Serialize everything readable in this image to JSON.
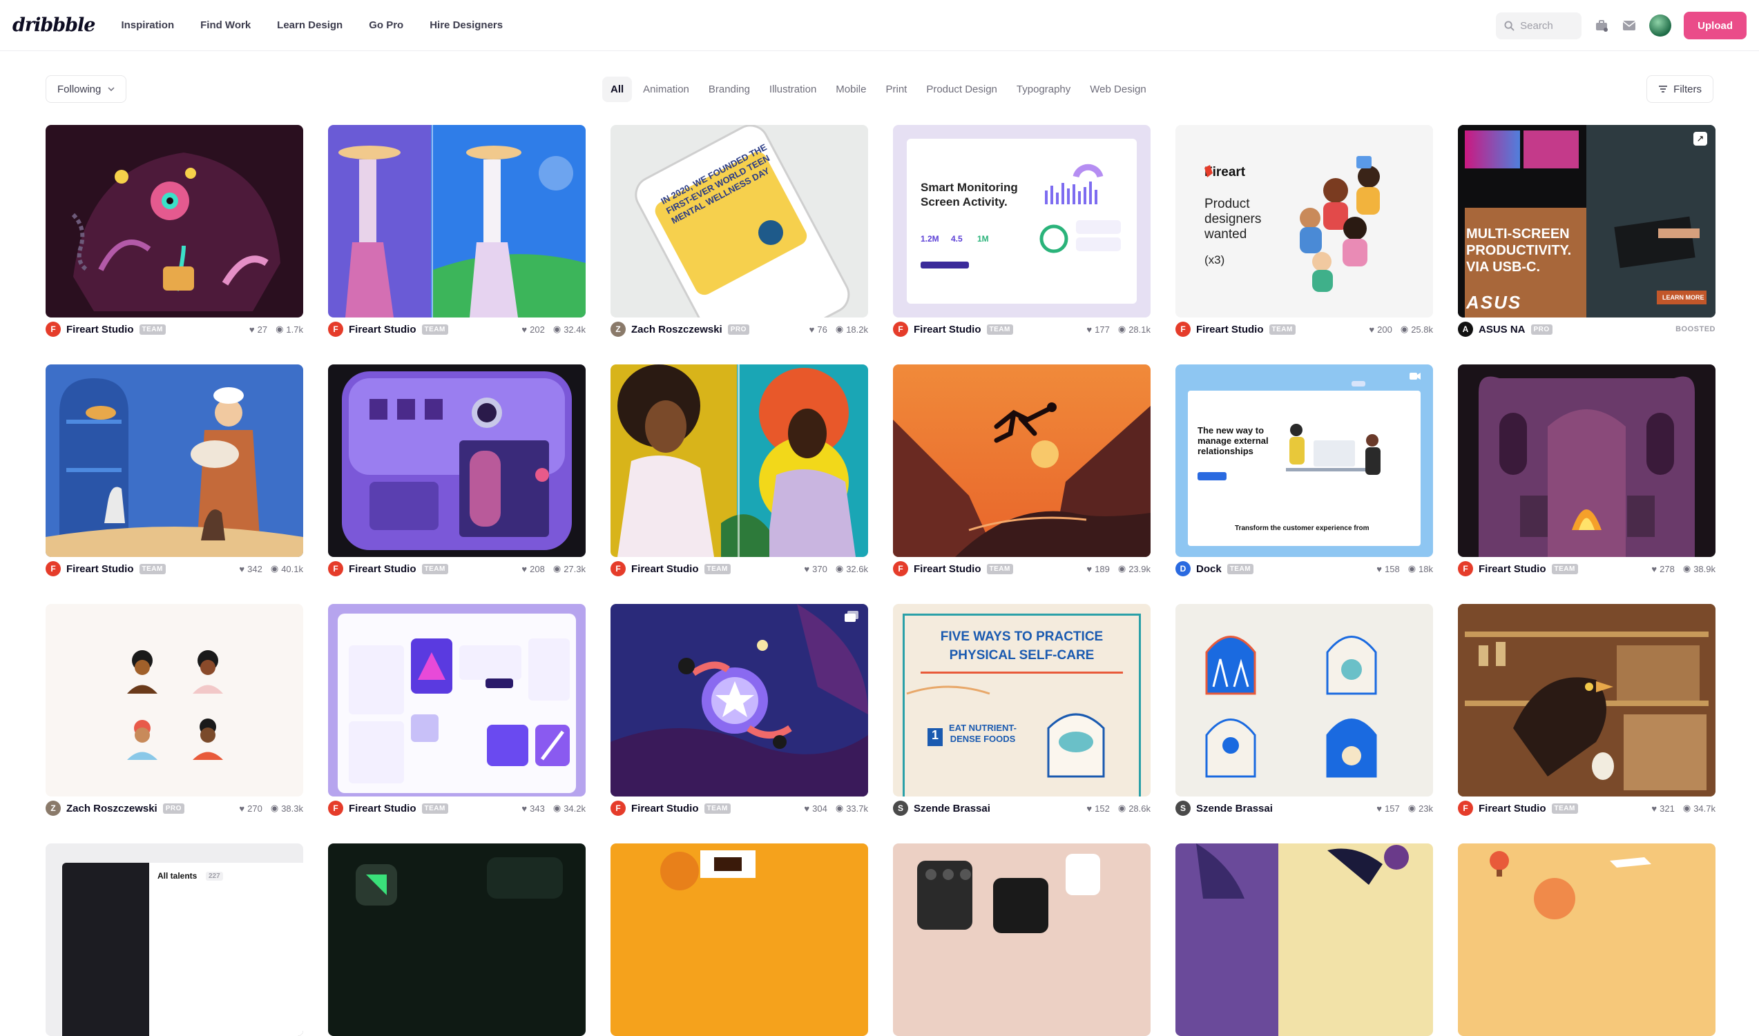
{
  "header": {
    "logo": "dribbble",
    "nav": [
      "Inspiration",
      "Find Work",
      "Learn Design",
      "Go Pro",
      "Hire Designers"
    ],
    "search_placeholder": "Search",
    "upload_label": "Upload"
  },
  "filterbar": {
    "following_label": "Following",
    "categories": [
      "All",
      "Animation",
      "Branding",
      "Illustration",
      "Mobile",
      "Print",
      "Product Design",
      "Typography",
      "Web Design"
    ],
    "active_category": "All",
    "filters_label": "Filters"
  },
  "colors": {
    "accent": "#ea4c89",
    "fireart": "#e53c2a"
  },
  "shots": [
    {
      "author": "Fireart Studio",
      "badge": "TEAM",
      "likes": "27",
      "views": "1.7k"
    },
    {
      "author": "Fireart Studio",
      "badge": "TEAM",
      "likes": "202",
      "views": "32.4k"
    },
    {
      "author": "Zach Roszczewski",
      "badge": "PRO",
      "likes": "76",
      "views": "18.2k"
    },
    {
      "author": "Fireart Studio",
      "badge": "TEAM",
      "likes": "177",
      "views": "28.1k"
    },
    {
      "author": "Fireart Studio",
      "badge": "TEAM",
      "likes": "200",
      "views": "25.8k"
    },
    {
      "author": "ASUS NA",
      "badge": "PRO",
      "boosted": "BOOSTED"
    },
    {
      "author": "Fireart Studio",
      "badge": "TEAM",
      "likes": "342",
      "views": "40.1k"
    },
    {
      "author": "Fireart Studio",
      "badge": "TEAM",
      "likes": "208",
      "views": "27.3k"
    },
    {
      "author": "Fireart Studio",
      "badge": "TEAM",
      "likes": "370",
      "views": "32.6k"
    },
    {
      "author": "Fireart Studio",
      "badge": "TEAM",
      "likes": "189",
      "views": "23.9k"
    },
    {
      "author": "Dock",
      "badge": "TEAM",
      "likes": "158",
      "views": "18k"
    },
    {
      "author": "Fireart Studio",
      "badge": "TEAM",
      "likes": "278",
      "views": "38.9k"
    },
    {
      "author": "Zach Roszczewski",
      "badge": "PRO",
      "likes": "270",
      "views": "38.3k"
    },
    {
      "author": "Fireart Studio",
      "badge": "TEAM",
      "likes": "343",
      "views": "34.2k"
    },
    {
      "author": "Fireart Studio",
      "badge": "TEAM",
      "likes": "304",
      "views": "33.7k"
    },
    {
      "author": "Szende Brassai",
      "badge": "",
      "likes": "152",
      "views": "28.6k"
    },
    {
      "author": "Szende Brassai",
      "badge": "",
      "likes": "157",
      "views": "23k"
    },
    {
      "author": "Fireart Studio",
      "badge": "TEAM",
      "likes": "321",
      "views": "34.7k"
    }
  ],
  "thumb_text": {
    "monitoring_title": "Smart Monitoring Screen Activity.",
    "monitoring_stats": [
      "1.2M",
      "4.5",
      "1M"
    ],
    "fireart_brand": "Fireart",
    "fireart_lines": [
      "Product",
      "designers",
      "wanted",
      "(x3)"
    ],
    "asus_headline": "MULTI-SCREEN PRODUCTIVITY. VIA USB-C.",
    "asus_logo": "ASUS",
    "asus_cta": "LEARN MORE",
    "dock_title": "The new way to manage external relationships",
    "dock_footer": "Transform the customer experience from",
    "selfcare_title": "FIVE WAYS TO PRACTICE PHYSICAL SELF-CARE",
    "selfcare_item": "EAT NUTRIENT-DENSE FOODS",
    "selfcare_number": "1",
    "talents_label": "All talents",
    "talents_count": "227",
    "phone_text": "IN 2020, WE FOUNDED THE FIRST-EVER WORLD TEEN MENTAL WELLNESS DAY"
  }
}
